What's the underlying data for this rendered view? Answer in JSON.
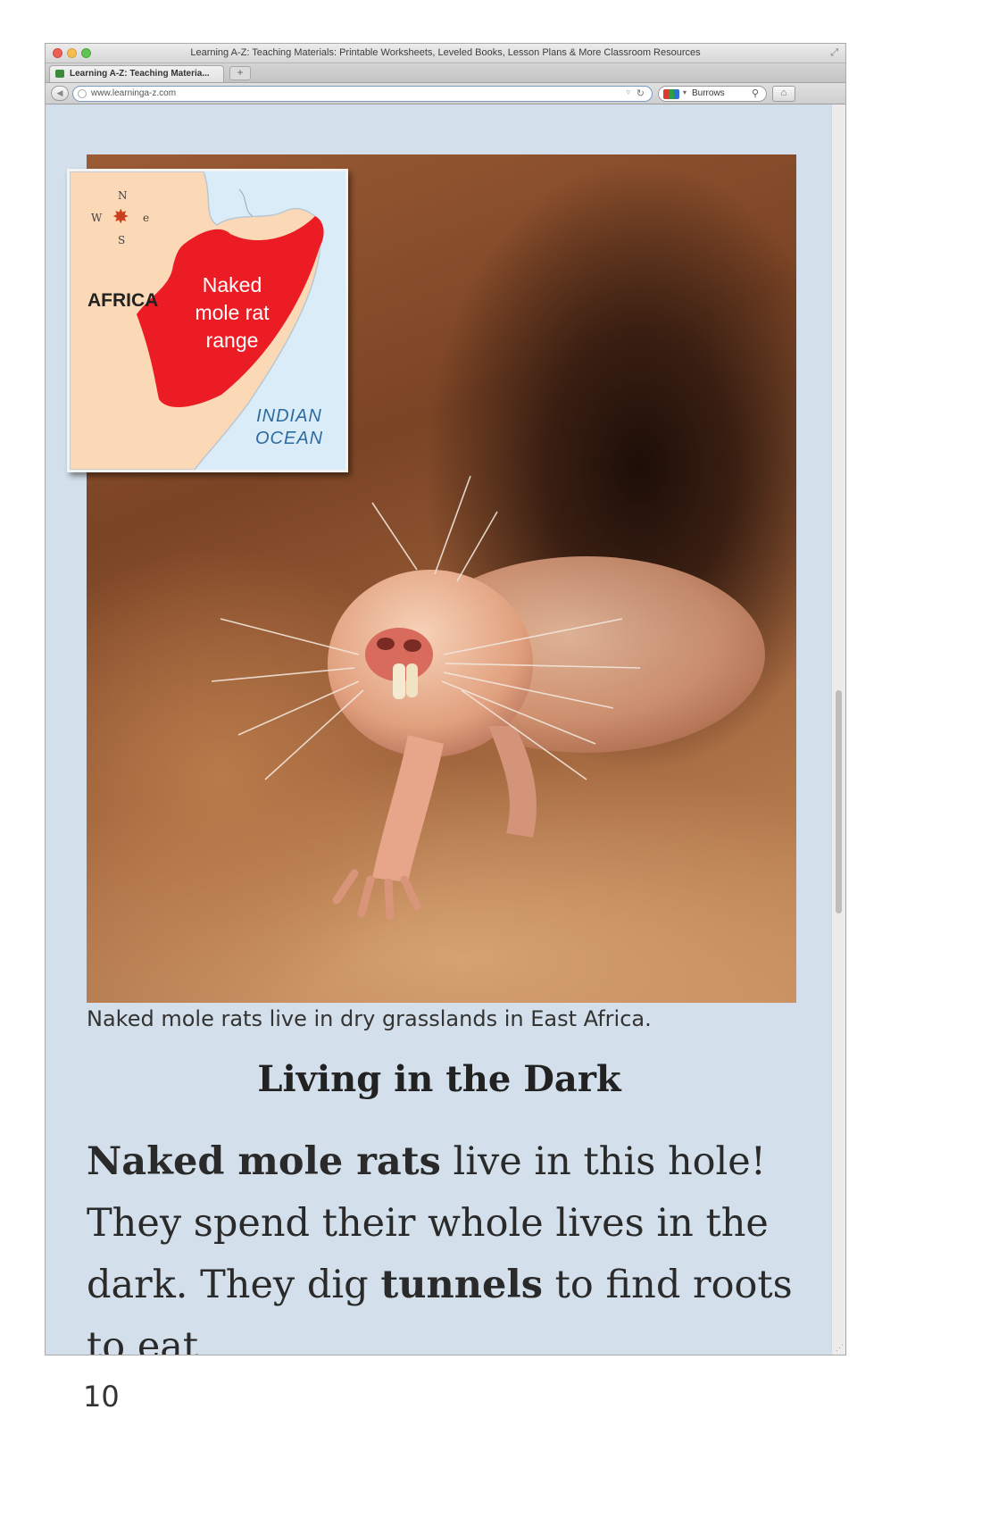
{
  "browser": {
    "window_title": "Learning A-Z: Teaching Materials: Printable Worksheets, Leveled Books, Lesson Plans & More Classroom Resources",
    "tab_label": "Learning A-Z: Teaching Materia...",
    "new_tab_label": "+",
    "url": "www.learninga-z.com",
    "search_text": "Burrows"
  },
  "map": {
    "compass": {
      "n": "N",
      "s": "S",
      "e": "e",
      "w": "W"
    },
    "continent_label": "AFRICA",
    "range_label": "Naked mole rat range",
    "ocean_label": "INDIAN OCEAN",
    "colors": {
      "land": "#fbd9b6",
      "water": "#d9ecf8",
      "range": "#ec1c24"
    }
  },
  "page": {
    "caption": "Naked mole rats live in dry grasslands in East Africa.",
    "heading": "Living in the Dark",
    "body": {
      "bold_1": "Naked mole rats",
      "text_1": " live in this hole! They spend their whole lives in the dark. They dig ",
      "bold_2": "tunnels",
      "text_2": " to find roots to eat."
    },
    "page_number": "10"
  }
}
